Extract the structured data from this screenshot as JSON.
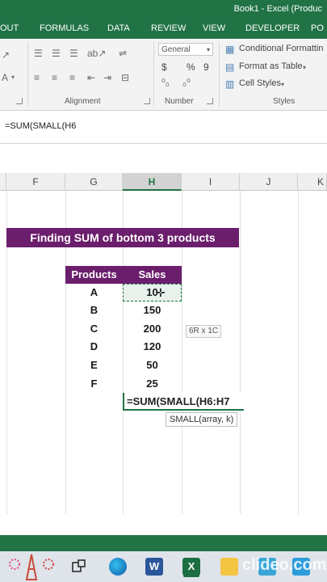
{
  "window": {
    "title": "Book1 - Excel (Produc"
  },
  "ribbon_tabs": [
    "OUT",
    "FORMULAS",
    "DATA",
    "REVIEW",
    "VIEW",
    "DEVELOPER",
    "PO"
  ],
  "ribbon": {
    "groups": {
      "alignment": "Alignment",
      "number": "Number",
      "styles": "Styles"
    },
    "number_format": "General",
    "number_symbols": {
      "currency": "$",
      "percent": "%",
      "comma": "9"
    },
    "styles_buttons": {
      "conditional": "Conditional Formattin",
      "table": "Format as Table",
      "cell_styles": "Cell Styles"
    }
  },
  "formula_bar": {
    "text": "=SUM(SMALL(H6"
  },
  "columns": {
    "f": "F",
    "g": "G",
    "h": "H",
    "i": "I",
    "j": "J",
    "k": "K"
  },
  "sheet": {
    "banner": "Finding SUM of bottom 3 products",
    "header_products": "Products",
    "header_sales": "Sales",
    "rows": [
      {
        "product": "A",
        "sales": "10"
      },
      {
        "product": "B",
        "sales": "150"
      },
      {
        "product": "C",
        "sales": "200"
      },
      {
        "product": "D",
        "sales": "120"
      },
      {
        "product": "E",
        "sales": "50"
      },
      {
        "product": "F",
        "sales": "25"
      }
    ],
    "size_hint": "6R x 1C",
    "edit_formula": "=SUM(SMALL(H6:H7",
    "tooltip": "SMALL(array, k)"
  },
  "taskbar": {
    "watermark": "clideo.com"
  },
  "colors": {
    "excel_green": "#217346",
    "banner_purple": "#6a1e6b"
  }
}
